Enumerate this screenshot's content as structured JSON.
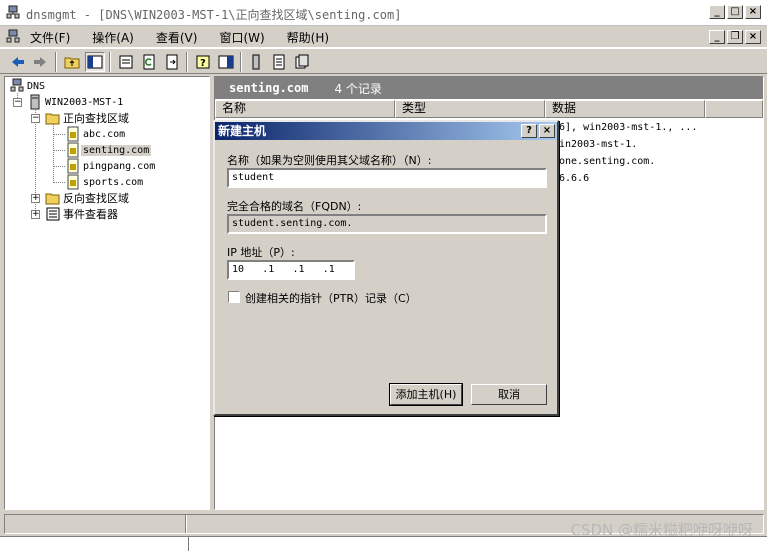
{
  "window": {
    "title": "dnsmgmt - [DNS\\WIN2003-MST-1\\正向查找区域\\senting.com]"
  },
  "menu": {
    "items": [
      "文件(F)",
      "操作(A)",
      "查看(V)",
      "窗口(W)",
      "帮助(H)"
    ]
  },
  "tree": {
    "root": "DNS",
    "server": "WIN2003-MST-1",
    "forward_zone": "正向查找区域",
    "zones": [
      "abc.com",
      "senting.com",
      "pingpang.com",
      "sports.com"
    ],
    "reverse_zone": "反向查找区域",
    "event_viewer": "事件查看器"
  },
  "right_pane": {
    "zone_name": "senting.com",
    "record_count": "4 个记录",
    "columns": [
      "名称",
      "类型",
      "数据"
    ],
    "data_cells": [
      "6], win2003-mst-1., ...",
      "in2003-mst-1.",
      "one.senting.com.",
      "6.6.6"
    ]
  },
  "dialog": {
    "title": "新建主机",
    "name_label": "名称（如果为空则使用其父域名称）（N）:",
    "name_value": "student",
    "fqdn_label": "完全合格的域名（FQDN）:",
    "fqdn_value": "student.senting.com.",
    "ip_label": "IP 地址（P）:",
    "ip_segments": [
      "10",
      ".1",
      ".1",
      ".1"
    ],
    "ptr_label": "创建相关的指针（PTR）记录（C）",
    "ptr_checked": false,
    "add_button": "添加主机(H)",
    "cancel_button": "取消"
  },
  "watermark": "CSDN @糯米糍粑咿呀咿呀",
  "colors": {
    "dialog_title_start": "#0a246a",
    "dialog_title_end": "#a6caf0",
    "face": "#d4d0c8",
    "pane_header": "#808080"
  }
}
